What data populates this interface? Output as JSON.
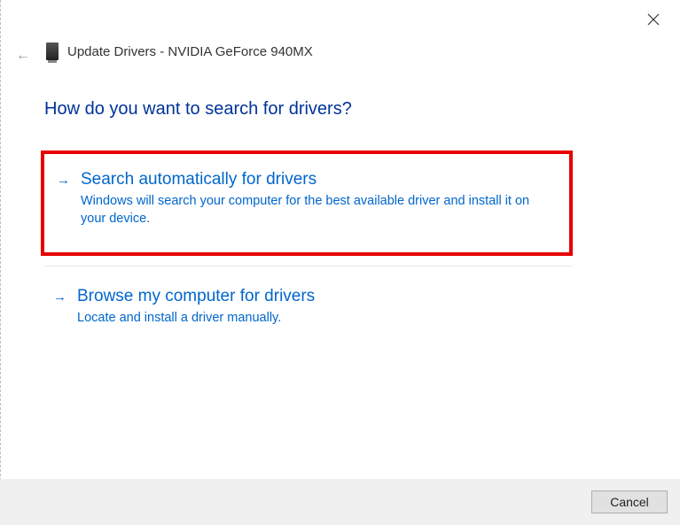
{
  "header": {
    "title": "Update Drivers - NVIDIA GeForce 940MX"
  },
  "question": "How do you want to search for drivers?",
  "options": [
    {
      "title": "Search automatically for drivers",
      "description": "Windows will search your computer for the best available driver and install it on your device."
    },
    {
      "title": "Browse my computer for drivers",
      "description": "Locate and install a driver manually."
    }
  ],
  "buttons": {
    "cancel": "Cancel"
  }
}
